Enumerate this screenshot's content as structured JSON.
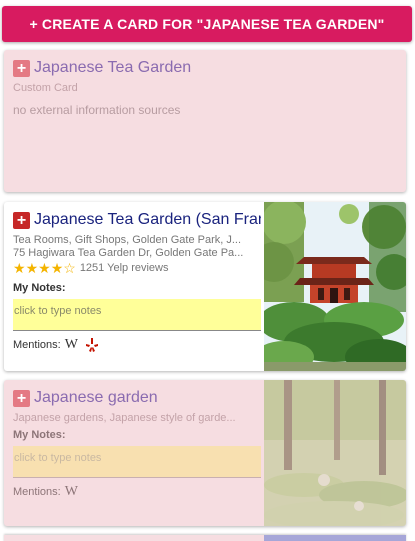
{
  "create_button": {
    "label": "+ CREATE A CARD FOR \"JAPANESE TEA GARDEN\""
  },
  "cards": [
    {
      "title": "Japanese Tea Garden",
      "subtitle": "Custom Card",
      "info": "no external information sources"
    },
    {
      "title": "Japanese Tea Garden (San Francisco)",
      "categories": "Tea Rooms, Gift Shops, Golden Gate Park, J...",
      "address": "75 Hagiwara Tea Garden Dr, Golden Gate Pa...",
      "rating": 4,
      "rating_max": 5,
      "reviews": "1251 Yelp reviews",
      "notes_label": "My Notes:",
      "notes_placeholder": "click to type notes",
      "mentions_label": "Mentions:",
      "mention_icons": [
        "wikipedia-icon",
        "yelp-icon"
      ]
    },
    {
      "title": "Japanese garden",
      "subtitle": "Japanese gardens, Japanese style of garde...",
      "notes_label": "My Notes:",
      "notes_placeholder": "click to type notes",
      "mentions_label": "Mentions:",
      "mention_icons": [
        "wikipedia-icon"
      ]
    }
  ],
  "colors": {
    "accent": "#d81b60",
    "card_faded_bg": "#f6dde1",
    "notes_active_bg": "#ffff99",
    "title_active": "#1a237e",
    "title_faded": "#8a6bb0"
  }
}
